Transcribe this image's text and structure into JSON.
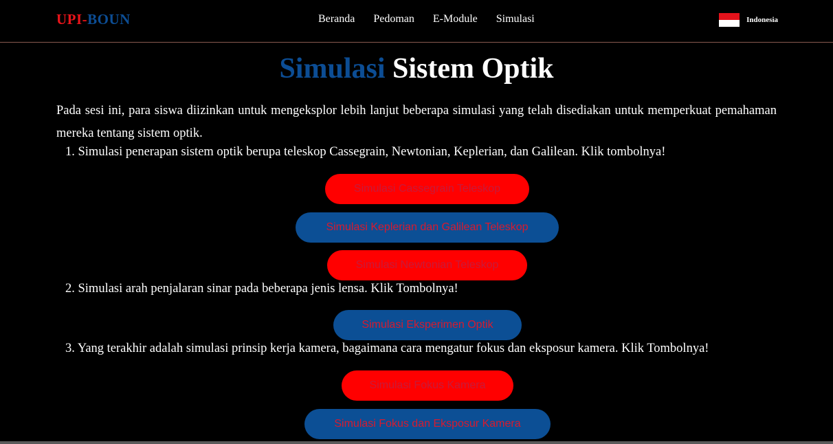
{
  "brand": {
    "part1": "UPI-",
    "part2": "BOUN"
  },
  "nav": {
    "items": [
      "Beranda",
      "Pedoman",
      "E-Module",
      "Simulasi"
    ]
  },
  "language": {
    "label": "Indonesia",
    "flag_colors": [
      "#e3121b",
      "#ffffff"
    ]
  },
  "title": {
    "part1": "Simulasi",
    "part2": " Sistem Optik"
  },
  "intro": "Pada sesi ini, para siswa diizinkan untuk mengeksplor lebih lanjut beberapa simulasi yang telah disediakan untuk memperkuat pemahaman mereka tentang sistem optik.",
  "items": [
    {
      "text": "1. Simulasi penerapan sistem optik berupa teleskop Cassegrain, Newtonian, Keplerian, dan Galilean. Klik tombolnya!"
    },
    {
      "text": "2. Simulasi arah penjalaran sinar pada beberapa jenis lensa. Klik Tombolnya!"
    },
    {
      "text": "3. Yang terakhir adalah simulasi prinsip kerja kamera, bagaimana cara mengatur fokus dan eksposur kamera. Klik Tombolnya!"
    }
  ],
  "buttons": {
    "cassegrain": "Simulasi Cassegrain Teleskop",
    "keplerian_galilean": "Simulasi Keplerian dan Galilean Teleskop",
    "newtonian": "Simulasi Newtonian Teleskop",
    "eksperimen_optik": "Simulasi Eksperimen Optik",
    "fokus_kamera": "Simulasi Fokus Kamera",
    "fokus_eksposur": "Simulasi Fokus dan Eksposur Kamera"
  },
  "colors": {
    "accent_blue": "#0c4d94",
    "accent_red": "#ff0000",
    "background": "#000000"
  }
}
